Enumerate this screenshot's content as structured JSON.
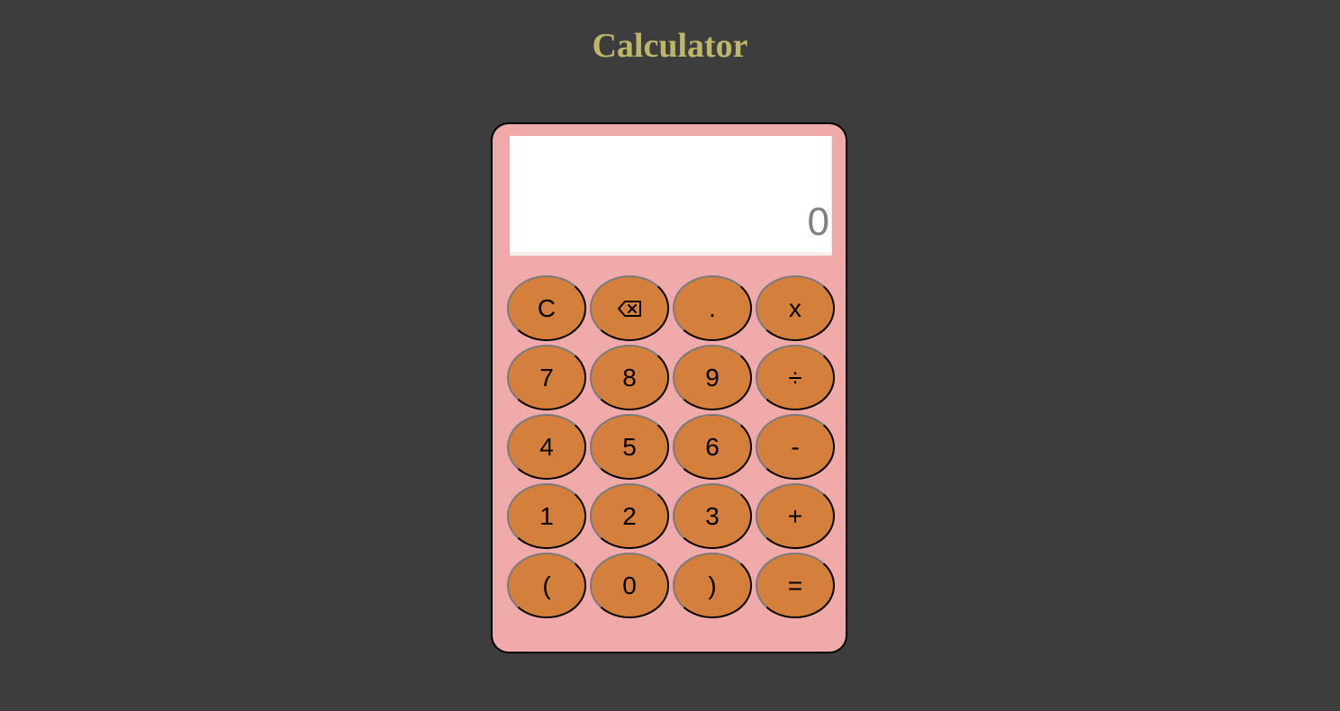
{
  "page": {
    "title": "Calculator",
    "background": "#3d3d3d",
    "title_color": "#bdb76b"
  },
  "calculator": {
    "body_color": "#f0aaaa",
    "key_color": "#d4803c",
    "display": {
      "value": "0"
    },
    "keys": [
      {
        "label": "C",
        "name": "clear-button"
      },
      {
        "label": "",
        "name": "backspace-button",
        "icon": "backspace-icon"
      },
      {
        "label": ".",
        "name": "decimal-button"
      },
      {
        "label": "x",
        "name": "multiply-button"
      },
      {
        "label": "7",
        "name": "digit-7-button"
      },
      {
        "label": "8",
        "name": "digit-8-button"
      },
      {
        "label": "9",
        "name": "digit-9-button"
      },
      {
        "label": "÷",
        "name": "divide-button"
      },
      {
        "label": "4",
        "name": "digit-4-button"
      },
      {
        "label": "5",
        "name": "digit-5-button"
      },
      {
        "label": "6",
        "name": "digit-6-button"
      },
      {
        "label": "-",
        "name": "subtract-button"
      },
      {
        "label": "1",
        "name": "digit-1-button"
      },
      {
        "label": "2",
        "name": "digit-2-button"
      },
      {
        "label": "3",
        "name": "digit-3-button"
      },
      {
        "label": "+",
        "name": "add-button"
      },
      {
        "label": "(",
        "name": "open-paren-button"
      },
      {
        "label": "0",
        "name": "digit-0-button"
      },
      {
        "label": ")",
        "name": "close-paren-button"
      },
      {
        "label": "=",
        "name": "equals-button"
      }
    ]
  }
}
